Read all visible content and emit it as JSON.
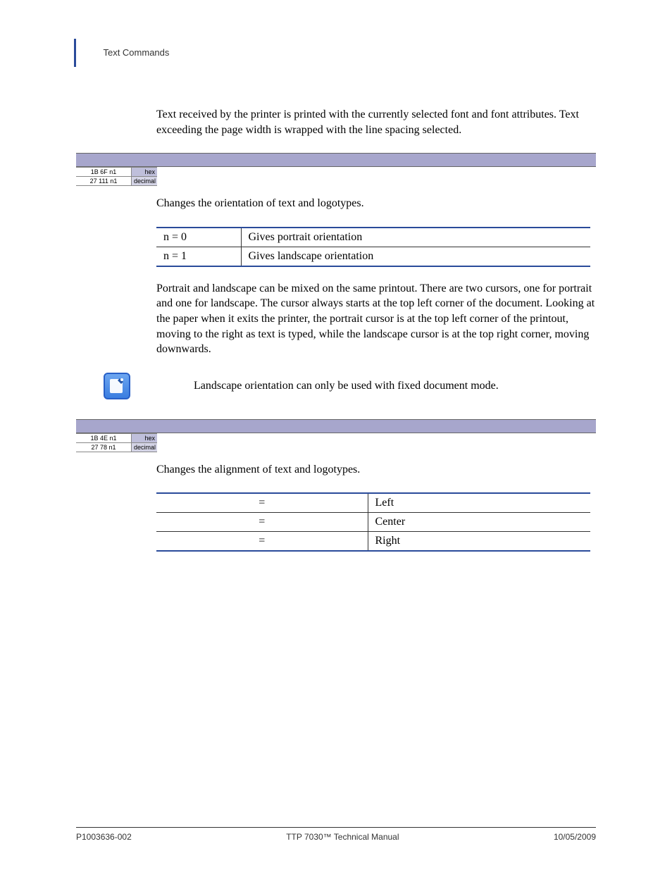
{
  "header": {
    "section": "Text Commands"
  },
  "intro": "Text received by the printer is printed with the currently selected font and font attributes. Text exceeding the page width is wrapped with the line spacing selected.",
  "command1": {
    "hex": "1B 6F  n1",
    "hex_label": "hex",
    "dec": "27 111  n1",
    "dec_label": "decimal",
    "desc": "Changes the orientation of text and logotypes.",
    "table": [
      {
        "param": "n = 0",
        "meaning": "Gives portrait orientation"
      },
      {
        "param": "n = 1",
        "meaning": "Gives landscape orientation"
      }
    ],
    "detail": "Portrait and landscape can be mixed on the same printout. There are two cursors, one for portrait and one for landscape. The cursor always starts at the top left corner of the document. Looking at the paper when it exits the printer, the portrait cursor is at the top left corner of the printout, moving to the right as text is typed, while the landscape cursor is at the top right corner, moving downwards.",
    "note": "Landscape orientation can only be used with fixed document mode."
  },
  "command2": {
    "hex": "1B 4E  n1",
    "hex_label": "hex",
    "dec": "27 78  n1",
    "dec_label": "decimal",
    "desc": "Changes the alignment of text and logotypes.",
    "table": [
      {
        "param": "=",
        "meaning": "Left"
      },
      {
        "param": "=",
        "meaning": "Center"
      },
      {
        "param": "=",
        "meaning": "Right"
      }
    ]
  },
  "footer": {
    "left": "P1003636-002",
    "center": "TTP 7030™ Technical Manual",
    "right": "10/05/2009"
  }
}
